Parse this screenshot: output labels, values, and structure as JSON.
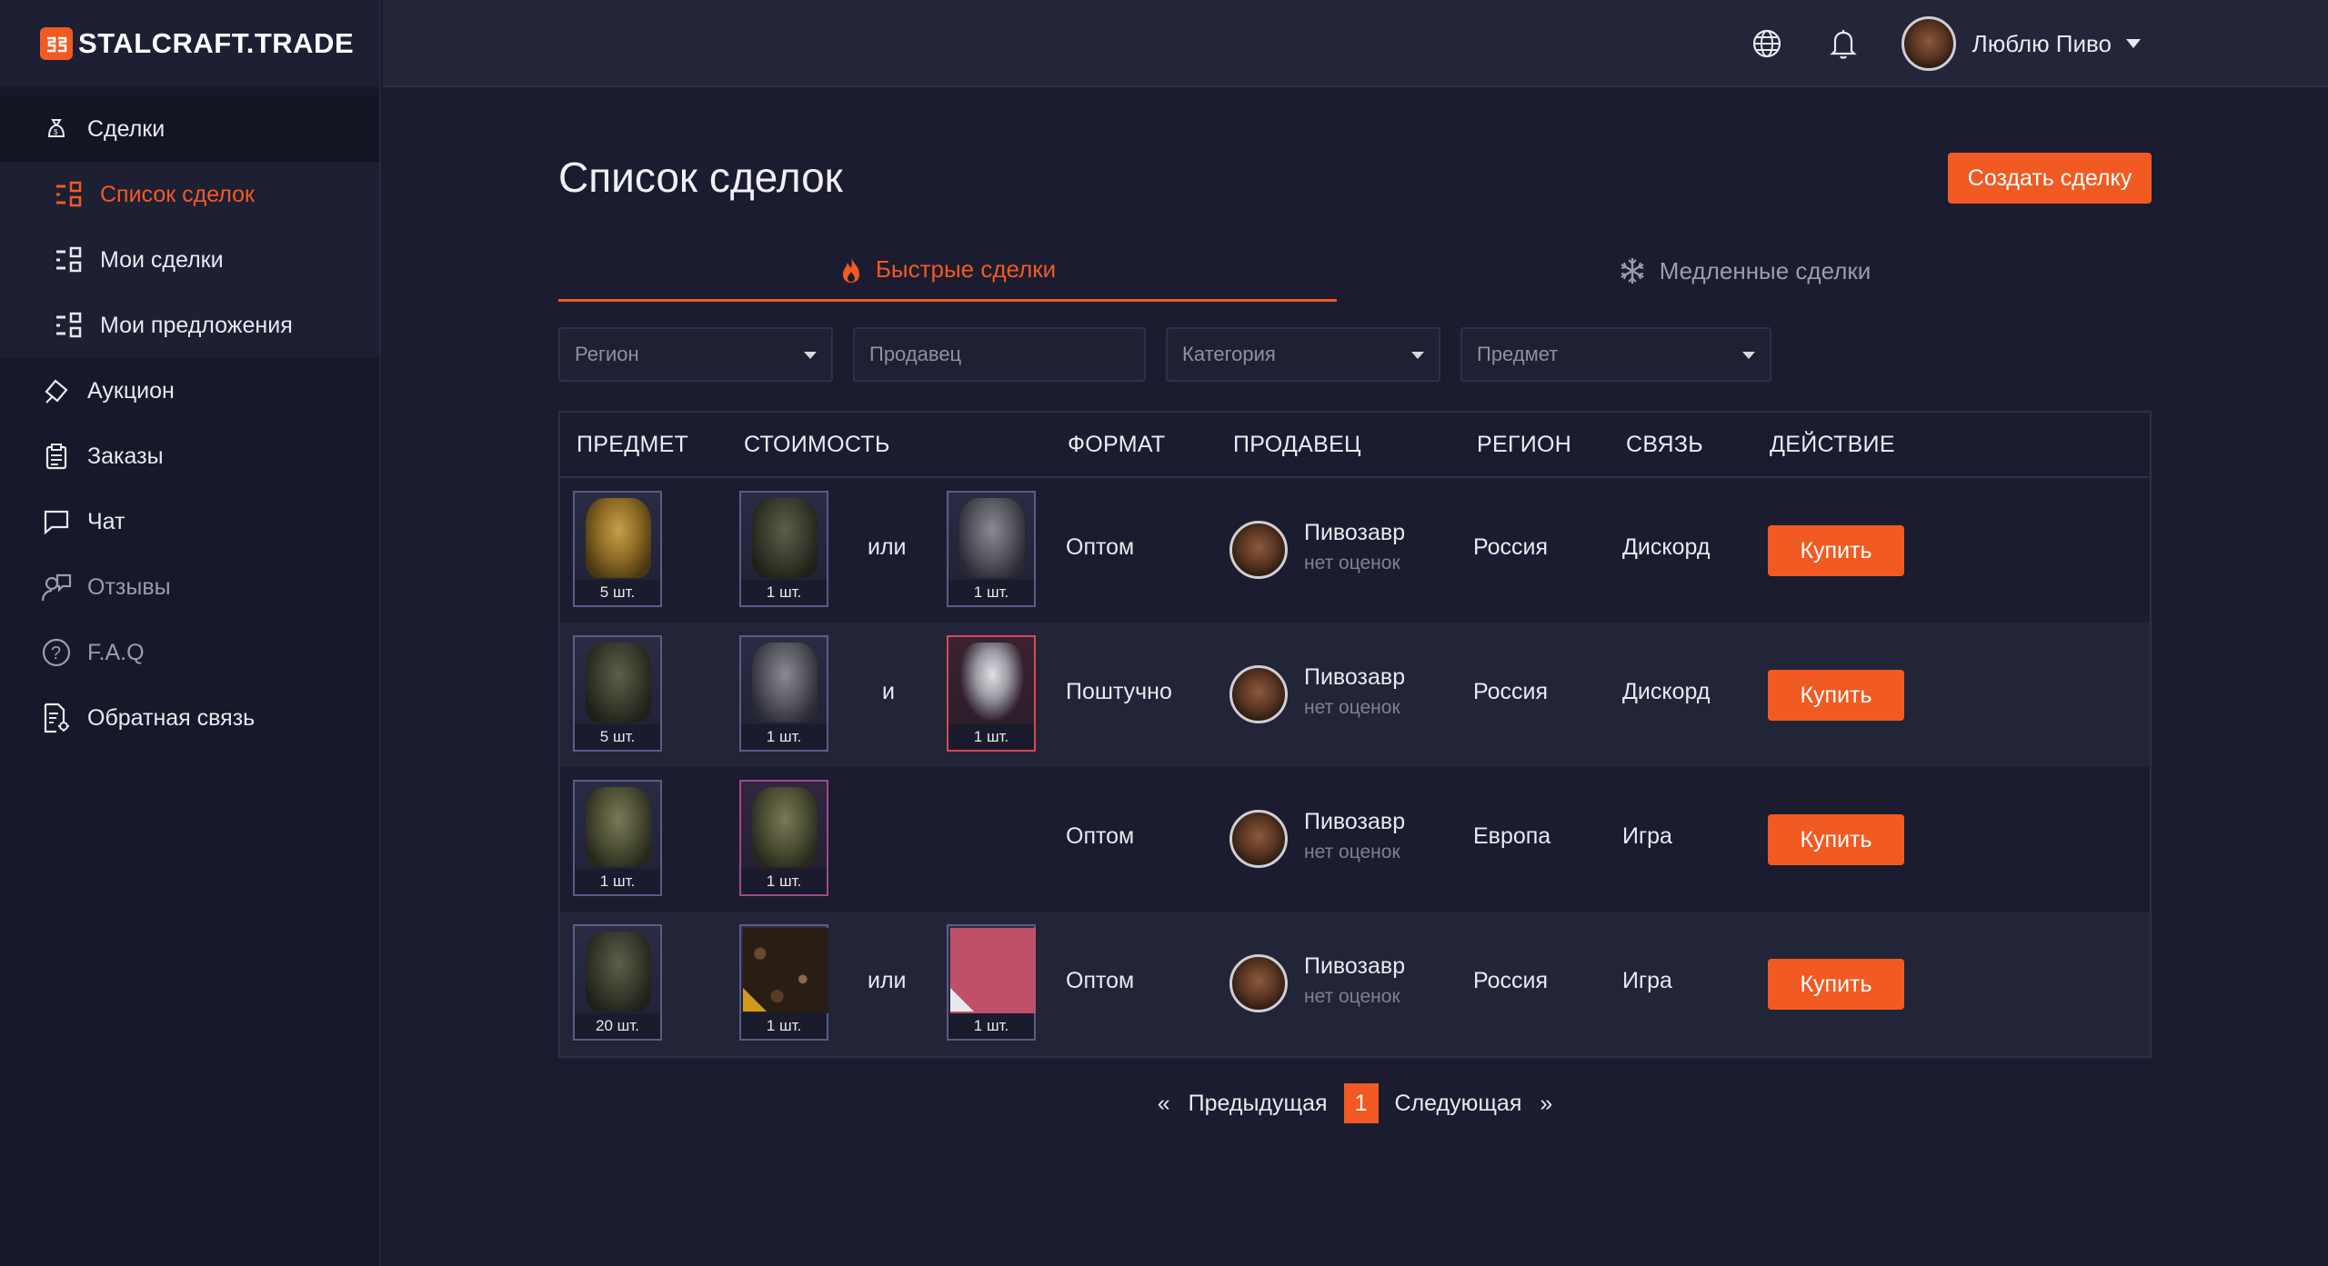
{
  "logo": {
    "mark": "SS",
    "text": "STALCRAFT.TRADE"
  },
  "sidebar": {
    "deals_label": "Сделки",
    "sub_items": [
      {
        "label": "Список сделок",
        "active": true
      },
      {
        "label": "Мои сделки",
        "active": false
      },
      {
        "label": "Мои предложения",
        "active": false
      }
    ],
    "items": [
      {
        "label": "Аукцион"
      },
      {
        "label": "Заказы"
      },
      {
        "label": "Чат"
      },
      {
        "label": "Отзывы"
      },
      {
        "label": "F.A.Q"
      },
      {
        "label": "Обратная связь"
      }
    ]
  },
  "topbar": {
    "user_name": "Люблю Пиво"
  },
  "page": {
    "title": "Список сделок",
    "create_button": "Создать сделку"
  },
  "tabs": [
    {
      "label": "Быстрые сделки",
      "active": true
    },
    {
      "label": "Медленные сделки",
      "active": false
    }
  ],
  "filters": {
    "region": "Регион",
    "seller_placeholder": "Продавец",
    "category": "Категория",
    "item": "Предмет"
  },
  "table": {
    "headers": [
      "ПРЕДМЕТ",
      "СТОИМОСТЬ",
      "ФОРМАТ",
      "ПРОДАВЕЦ",
      "РЕГИОН",
      "СВЯЗЬ",
      "ДЕЙСТВИЕ"
    ],
    "rows": [
      {
        "item": {
          "qty": "5 шт.",
          "art": "gold"
        },
        "price1": {
          "qty": "1 шт.",
          "art": "dark"
        },
        "conj": "или",
        "price2": {
          "qty": "1 шт.",
          "art": "grey"
        },
        "format": "Оптом",
        "seller": "Пивозавр",
        "rating": "нет оценок",
        "region": "Россия",
        "contact": "Дискорд",
        "action": "Купить"
      },
      {
        "item": {
          "qty": "5 шт.",
          "art": "dark"
        },
        "price1": {
          "qty": "1 шт.",
          "art": "grey"
        },
        "conj": "и",
        "price2": {
          "qty": "1 шт.",
          "art": "tornado"
        },
        "format": "Поштучно",
        "seller": "Пивозавр",
        "rating": "нет оценок",
        "region": "Россия",
        "contact": "Дискорд",
        "action": "Купить"
      },
      {
        "item": {
          "qty": "1 шт.",
          "art": "camo"
        },
        "price1": {
          "qty": "1 шт.",
          "art": "camo"
        },
        "conj": "",
        "format": "Оптом",
        "seller": "Пивозавр",
        "rating": "нет оценок",
        "region": "Европа",
        "contact": "Игра",
        "action": "Купить"
      },
      {
        "item": {
          "qty": "20 шт.",
          "art": "dark"
        },
        "price1": {
          "qty": "1 шт.",
          "art": "rubble"
        },
        "conj": "или",
        "price2": {
          "qty": "1 шт.",
          "art": "pink"
        },
        "format": "Оптом",
        "seller": "Пивозавр",
        "rating": "нет оценок",
        "region": "Россия",
        "contact": "Игра",
        "action": "Купить"
      }
    ]
  },
  "pagination": {
    "prev": "Предыдущая",
    "current": "1",
    "next": "Следующая",
    "prev_arrow": "«",
    "next_arrow": "»"
  },
  "colors": {
    "accent": "#f15a22",
    "bg": "#1b1c2f",
    "sidebar": "#171829"
  },
  "icons": [
    "money-bag-icon",
    "list-icon",
    "auction-icon",
    "orders-icon",
    "chat-icon",
    "reviews-icon",
    "faq-icon",
    "feedback-icon",
    "globe-icon",
    "bell-icon",
    "fire-icon",
    "snowflake-icon"
  ]
}
